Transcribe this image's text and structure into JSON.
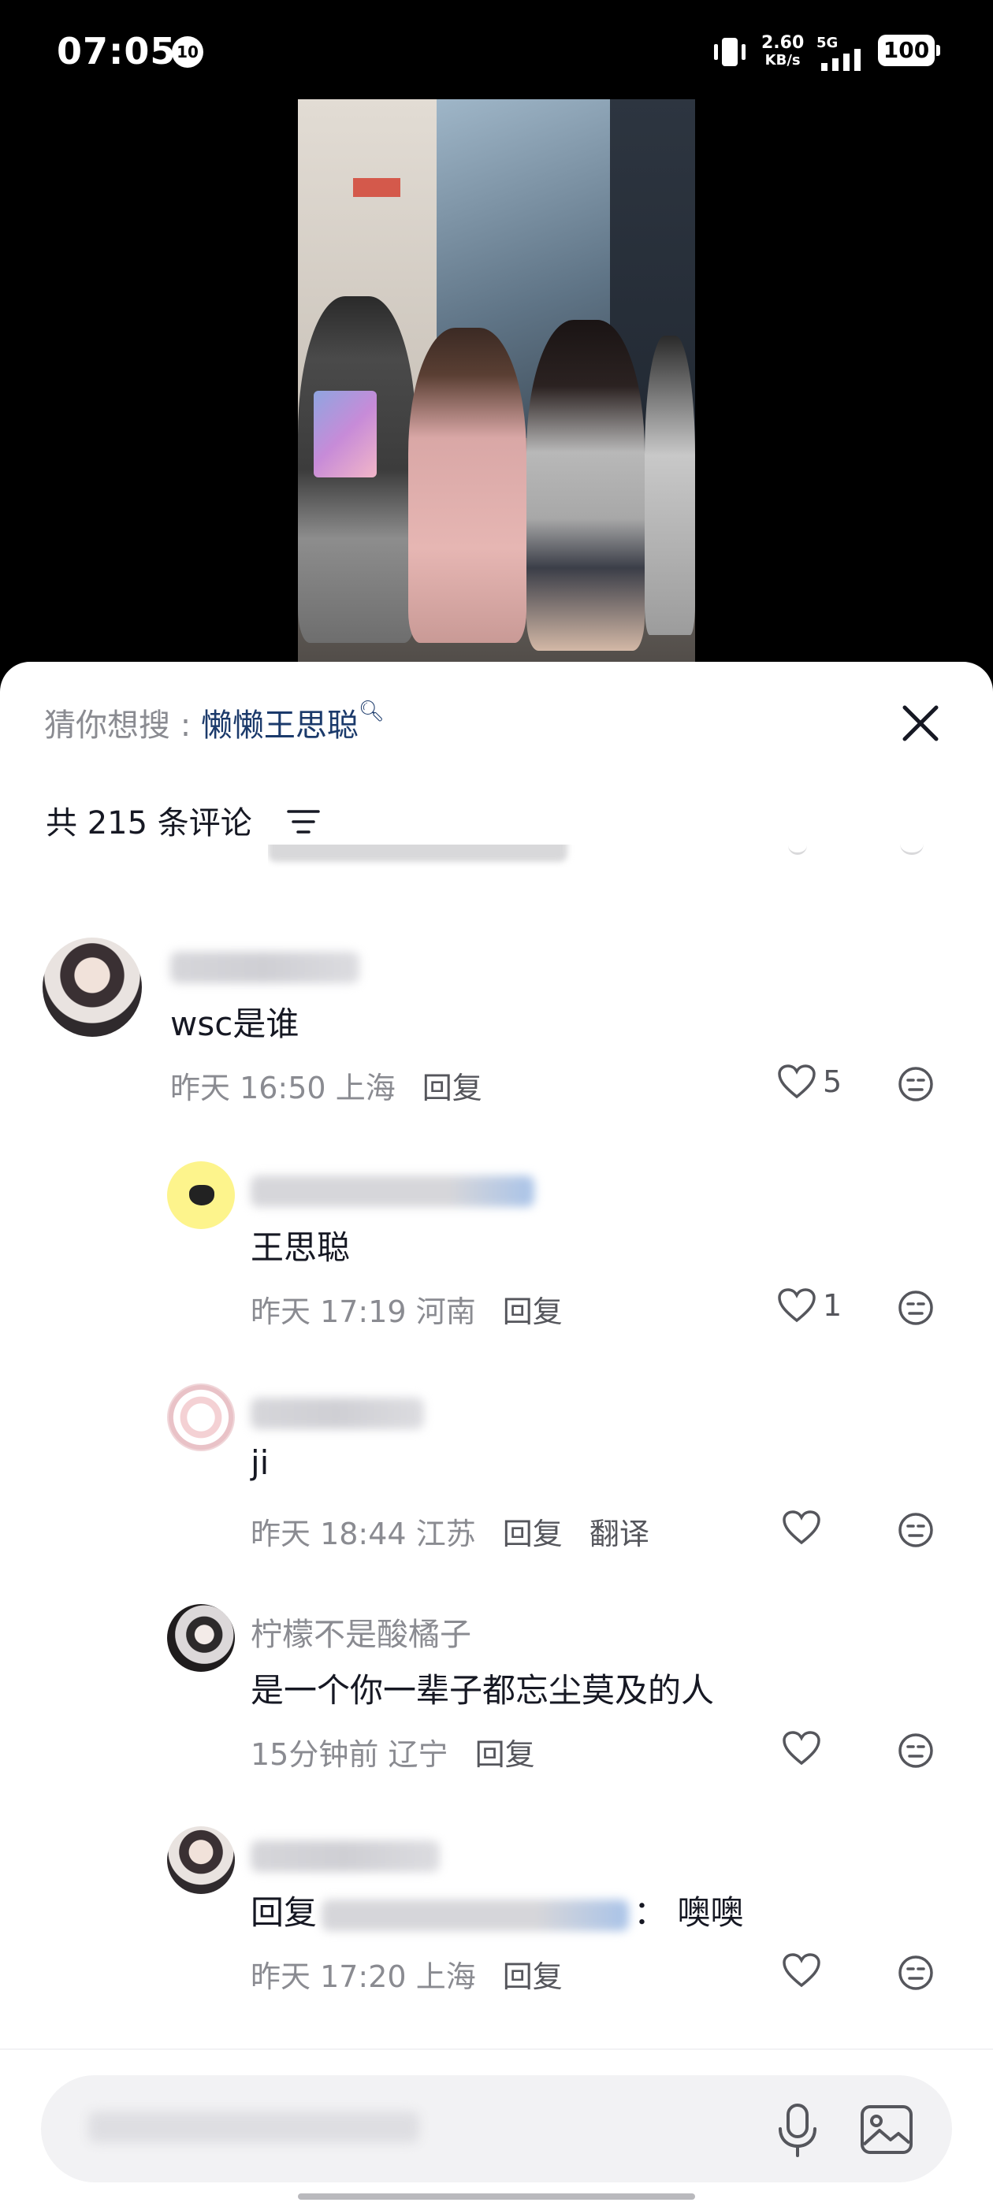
{
  "status_bar": {
    "time": "07:05",
    "notification_count": "10",
    "net_speed": "2.60",
    "net_unit": "KB/s",
    "network": "5G",
    "battery": "100"
  },
  "panel": {
    "search_prefix": "猜你想搜 : ",
    "search_keyword": "懒懒王思聪",
    "comment_count": "共 215 条评论"
  },
  "comments": [
    {
      "text": "wsc是谁",
      "time": "昨天 16:50",
      "location": "上海",
      "reply": "回复",
      "likes": "5"
    },
    {
      "text": "王思聪",
      "time": "昨天 17:19",
      "location": "河南",
      "reply": "回复",
      "likes": "1"
    },
    {
      "text": "ji",
      "time": "昨天 18:44",
      "location": "江苏",
      "reply": "回复",
      "translate": "翻译",
      "likes": ""
    },
    {
      "username": "柠檬不是酸橘子",
      "text": "是一个你一辈子都忘尘莫及的人",
      "time": "15分钟前",
      "location": "辽宁",
      "reply": "回复",
      "likes": ""
    },
    {
      "text_prefix": "回复",
      "text_suffix": "：  噢噢",
      "time": "昨天 17:20",
      "location": "上海",
      "reply": "回复",
      "likes": ""
    }
  ],
  "icons": {
    "close": "close-icon",
    "sort": "sort-icon",
    "heart": "heart-icon",
    "dislike": "dislike-face-icon",
    "mic": "mic-icon",
    "image": "image-icon"
  },
  "colors": {
    "keyword": "#1b3a6b",
    "muted": "#8a8b91",
    "panel_bg": "#ffffff",
    "input_bg": "#f2f2f4"
  }
}
